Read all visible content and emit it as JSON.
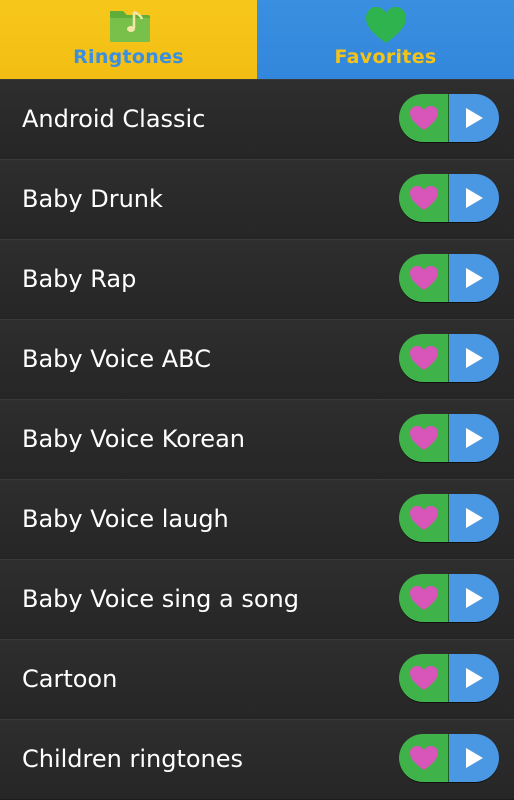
{
  "tabs": [
    {
      "label": "Ringtones",
      "icon": "folder-music-icon",
      "active": true
    },
    {
      "label": "Favorites",
      "icon": "heart-icon",
      "active": false
    }
  ],
  "ringtones": [
    {
      "title": "Android Classic"
    },
    {
      "title": "Baby Drunk"
    },
    {
      "title": "Baby Rap"
    },
    {
      "title": "Baby Voice ABC"
    },
    {
      "title": "Baby Voice Korean"
    },
    {
      "title": "Baby Voice laugh"
    },
    {
      "title": "Baby Voice sing a song"
    },
    {
      "title": "Cartoon"
    },
    {
      "title": "Children ringtones"
    }
  ],
  "colors": {
    "ringtones_tab_bg": "#f5c318",
    "favorites_tab_bg": "#3a8fe0",
    "favorite_button_bg": "#3fb24a",
    "heart": "#d855b9",
    "play_button_bg": "#4a97e3",
    "play_icon": "#ffffff"
  }
}
